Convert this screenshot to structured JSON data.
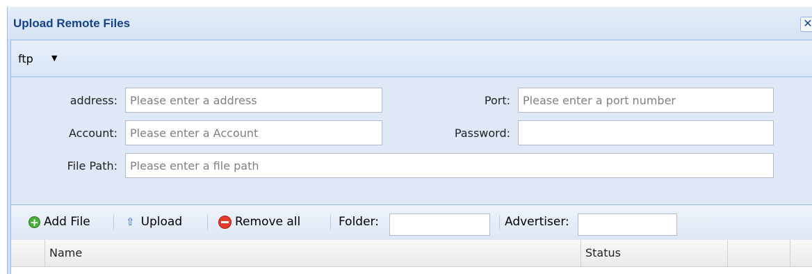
{
  "window": {
    "title": "Upload Remote Files",
    "close_icon": "close-icon"
  },
  "menubar": {
    "protocol": "ftp",
    "dropdown_icon": "caret-down-icon"
  },
  "form": {
    "address_label": "address:",
    "address_placeholder": "Please enter a address",
    "address_value": "",
    "port_label": "Port:",
    "port_placeholder": "Please enter a port number",
    "port_value": "",
    "account_label": "Account:",
    "account_placeholder": "Please enter a Account",
    "account_value": "",
    "password_label": "Password:",
    "password_value": "",
    "filepath_label": "File Path:",
    "filepath_placeholder": "Please enter a file path",
    "filepath_value": ""
  },
  "toolbar": {
    "add_label": "Add File",
    "upload_label": "Upload",
    "remove_label": "Remove all",
    "folder_label": "Folder:",
    "folder_value": "",
    "advertiser_label": "Advertiser:",
    "advertiser_value": "",
    "colors": {
      "add": "#4caf3c",
      "upload": "#2d6bc5",
      "remove": "#e23b2e"
    }
  },
  "grid": {
    "columns": [
      "",
      "Name",
      "Status",
      "",
      ""
    ]
  },
  "colors": {
    "title": "#15428b",
    "border": "#99bbe8",
    "panel": "#dfe8f6"
  }
}
